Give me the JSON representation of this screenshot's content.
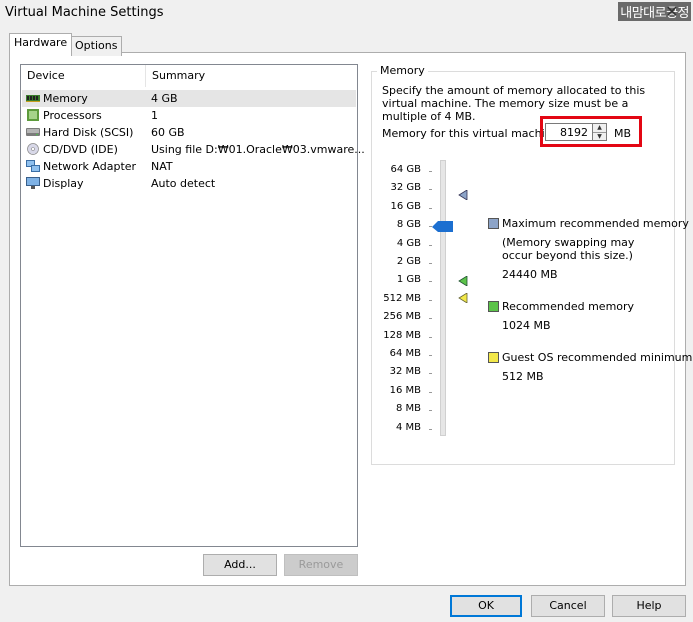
{
  "window": {
    "title": "Virtual Machine Settings",
    "watermark": "내맘대로긍정"
  },
  "tabs": [
    {
      "label": "Hardware"
    },
    {
      "label": "Options"
    }
  ],
  "device_list": {
    "headers": {
      "device": "Device",
      "summary": "Summary"
    },
    "rows": [
      {
        "device": "Memory",
        "summary": "4 GB",
        "icon": "memory-icon"
      },
      {
        "device": "Processors",
        "summary": "1",
        "icon": "processor-icon"
      },
      {
        "device": "Hard Disk (SCSI)",
        "summary": "60 GB",
        "icon": "hard-disk-icon"
      },
      {
        "device": "CD/DVD (IDE)",
        "summary": "Using file D:₩01.Oracle₩03.vmware...",
        "icon": "cd-dvd-icon"
      },
      {
        "device": "Network Adapter",
        "summary": "NAT",
        "icon": "network-adapter-icon"
      },
      {
        "device": "Display",
        "summary": "Auto detect",
        "icon": "display-icon"
      }
    ]
  },
  "device_buttons": {
    "add": "Add...",
    "remove": "Remove"
  },
  "memory": {
    "legend": "Memory",
    "description": "Specify the amount of memory allocated to this virtual machine. The memory size must be a multiple of 4 MB.",
    "field_label": "Memory for this virtual machine:",
    "value": "8192",
    "unit": "MB",
    "scale": [
      "64 GB",
      "32 GB",
      "16 GB",
      "8 GB",
      "4 GB",
      "2 GB",
      "1 GB",
      "512 MB",
      "256 MB",
      "128 MB",
      "64 MB",
      "32 MB",
      "16 MB",
      "8 MB",
      "4 MB"
    ],
    "legend_items": {
      "max": {
        "label": "Maximum recommended memory",
        "note": "(Memory swapping may occur beyond this size.)",
        "value": "24440 MB",
        "color": "#8da4c8"
      },
      "recommended": {
        "label": "Recommended memory",
        "value": "1024 MB",
        "color": "#5cc34a"
      },
      "guest_min": {
        "label": "Guest OS recommended minimum",
        "value": "512 MB",
        "color": "#f2e84a"
      }
    }
  },
  "footer": {
    "ok": "OK",
    "cancel": "Cancel",
    "help": "Help"
  }
}
